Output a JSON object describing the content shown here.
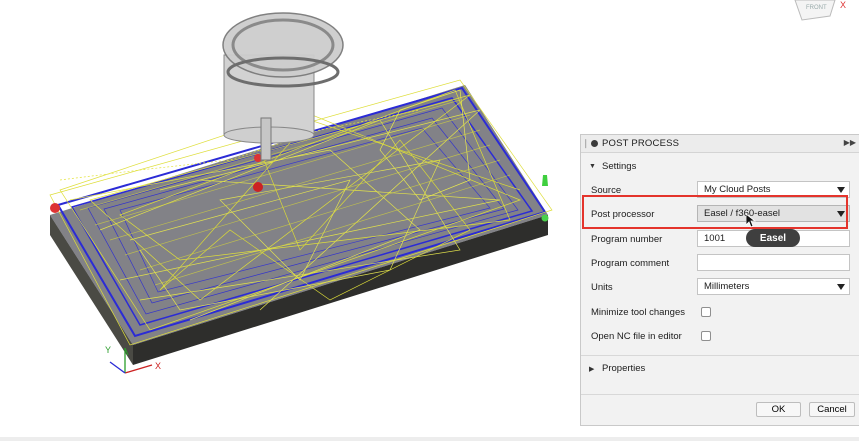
{
  "panel": {
    "title": "POST PROCESS",
    "settings_label": "Settings",
    "properties_label": "Properties"
  },
  "fields": {
    "source": {
      "label": "Source",
      "value": "My Cloud Posts"
    },
    "post_processor": {
      "label": "Post processor",
      "value": "Easel / f360-easel"
    },
    "program_number": {
      "label": "Program number",
      "value": "1001"
    },
    "program_comment": {
      "label": "Program comment",
      "value": ""
    },
    "units": {
      "label": "Units",
      "value": "Millimeters"
    },
    "minimize_tool_changes": {
      "label": "Minimize tool changes",
      "checked": false
    },
    "open_nc_file": {
      "label": "Open NC file in editor",
      "checked": false
    }
  },
  "tooltip": "Easel",
  "buttons": {
    "ok": "OK",
    "cancel": "Cancel"
  },
  "viewcube": {
    "face_label": "FRONT",
    "axis_label": "X"
  },
  "triad": {
    "x_label": "X",
    "y_label": "Y"
  },
  "colors": {
    "highlight": "#e4342c",
    "toolpath_yellow": "#dede3a",
    "toolpath_blue": "#2b2bd6",
    "stock_dark": "#3a3a3a"
  },
  "icons": [
    "grip-icon",
    "panel-dot-icon",
    "expand-icon",
    "collapse-triangle-icon",
    "expand-triangle-icon",
    "dropdown-arrow-icon",
    "mouse-cursor-icon"
  ]
}
